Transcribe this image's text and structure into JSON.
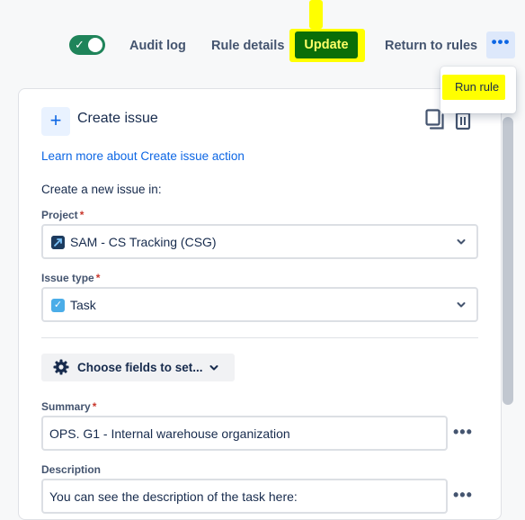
{
  "toolbar": {
    "toggle_state": "on",
    "audit_log": "Audit log",
    "rule_details": "Rule details",
    "update": "Update",
    "return_to_rules": "Return to rules",
    "more_label": "•••",
    "menu": {
      "run_rule": "Run rule"
    }
  },
  "panel": {
    "title": "Create issue",
    "plus_glyph": "+",
    "learn_more": "Learn more about Create issue action",
    "subheading": "Create a new issue in:",
    "project": {
      "label": "Project",
      "required": "*",
      "value": "SAM - CS Tracking (CSG)"
    },
    "issue_type": {
      "label": "Issue type",
      "required": "*",
      "value": "Task",
      "check_glyph": "✓"
    },
    "choose_fields": "Choose fields to set...",
    "summary": {
      "label": "Summary",
      "required": "*",
      "value": "OPS. G1 - Internal warehouse organization"
    },
    "description": {
      "label": "Description",
      "value": "You can see the description of the task here:"
    },
    "more_label": "•••"
  },
  "colors": {
    "accent": "#0c66e4",
    "update_bg": "#0a6e08",
    "highlight": "#ffff00",
    "toggle_on": "#1f845a"
  },
  "icons": [
    "check-icon",
    "more-icon",
    "plus-icon",
    "copy-icon",
    "trash-icon",
    "chevron-down-icon",
    "project-icon",
    "task-icon",
    "gear-icon"
  ]
}
